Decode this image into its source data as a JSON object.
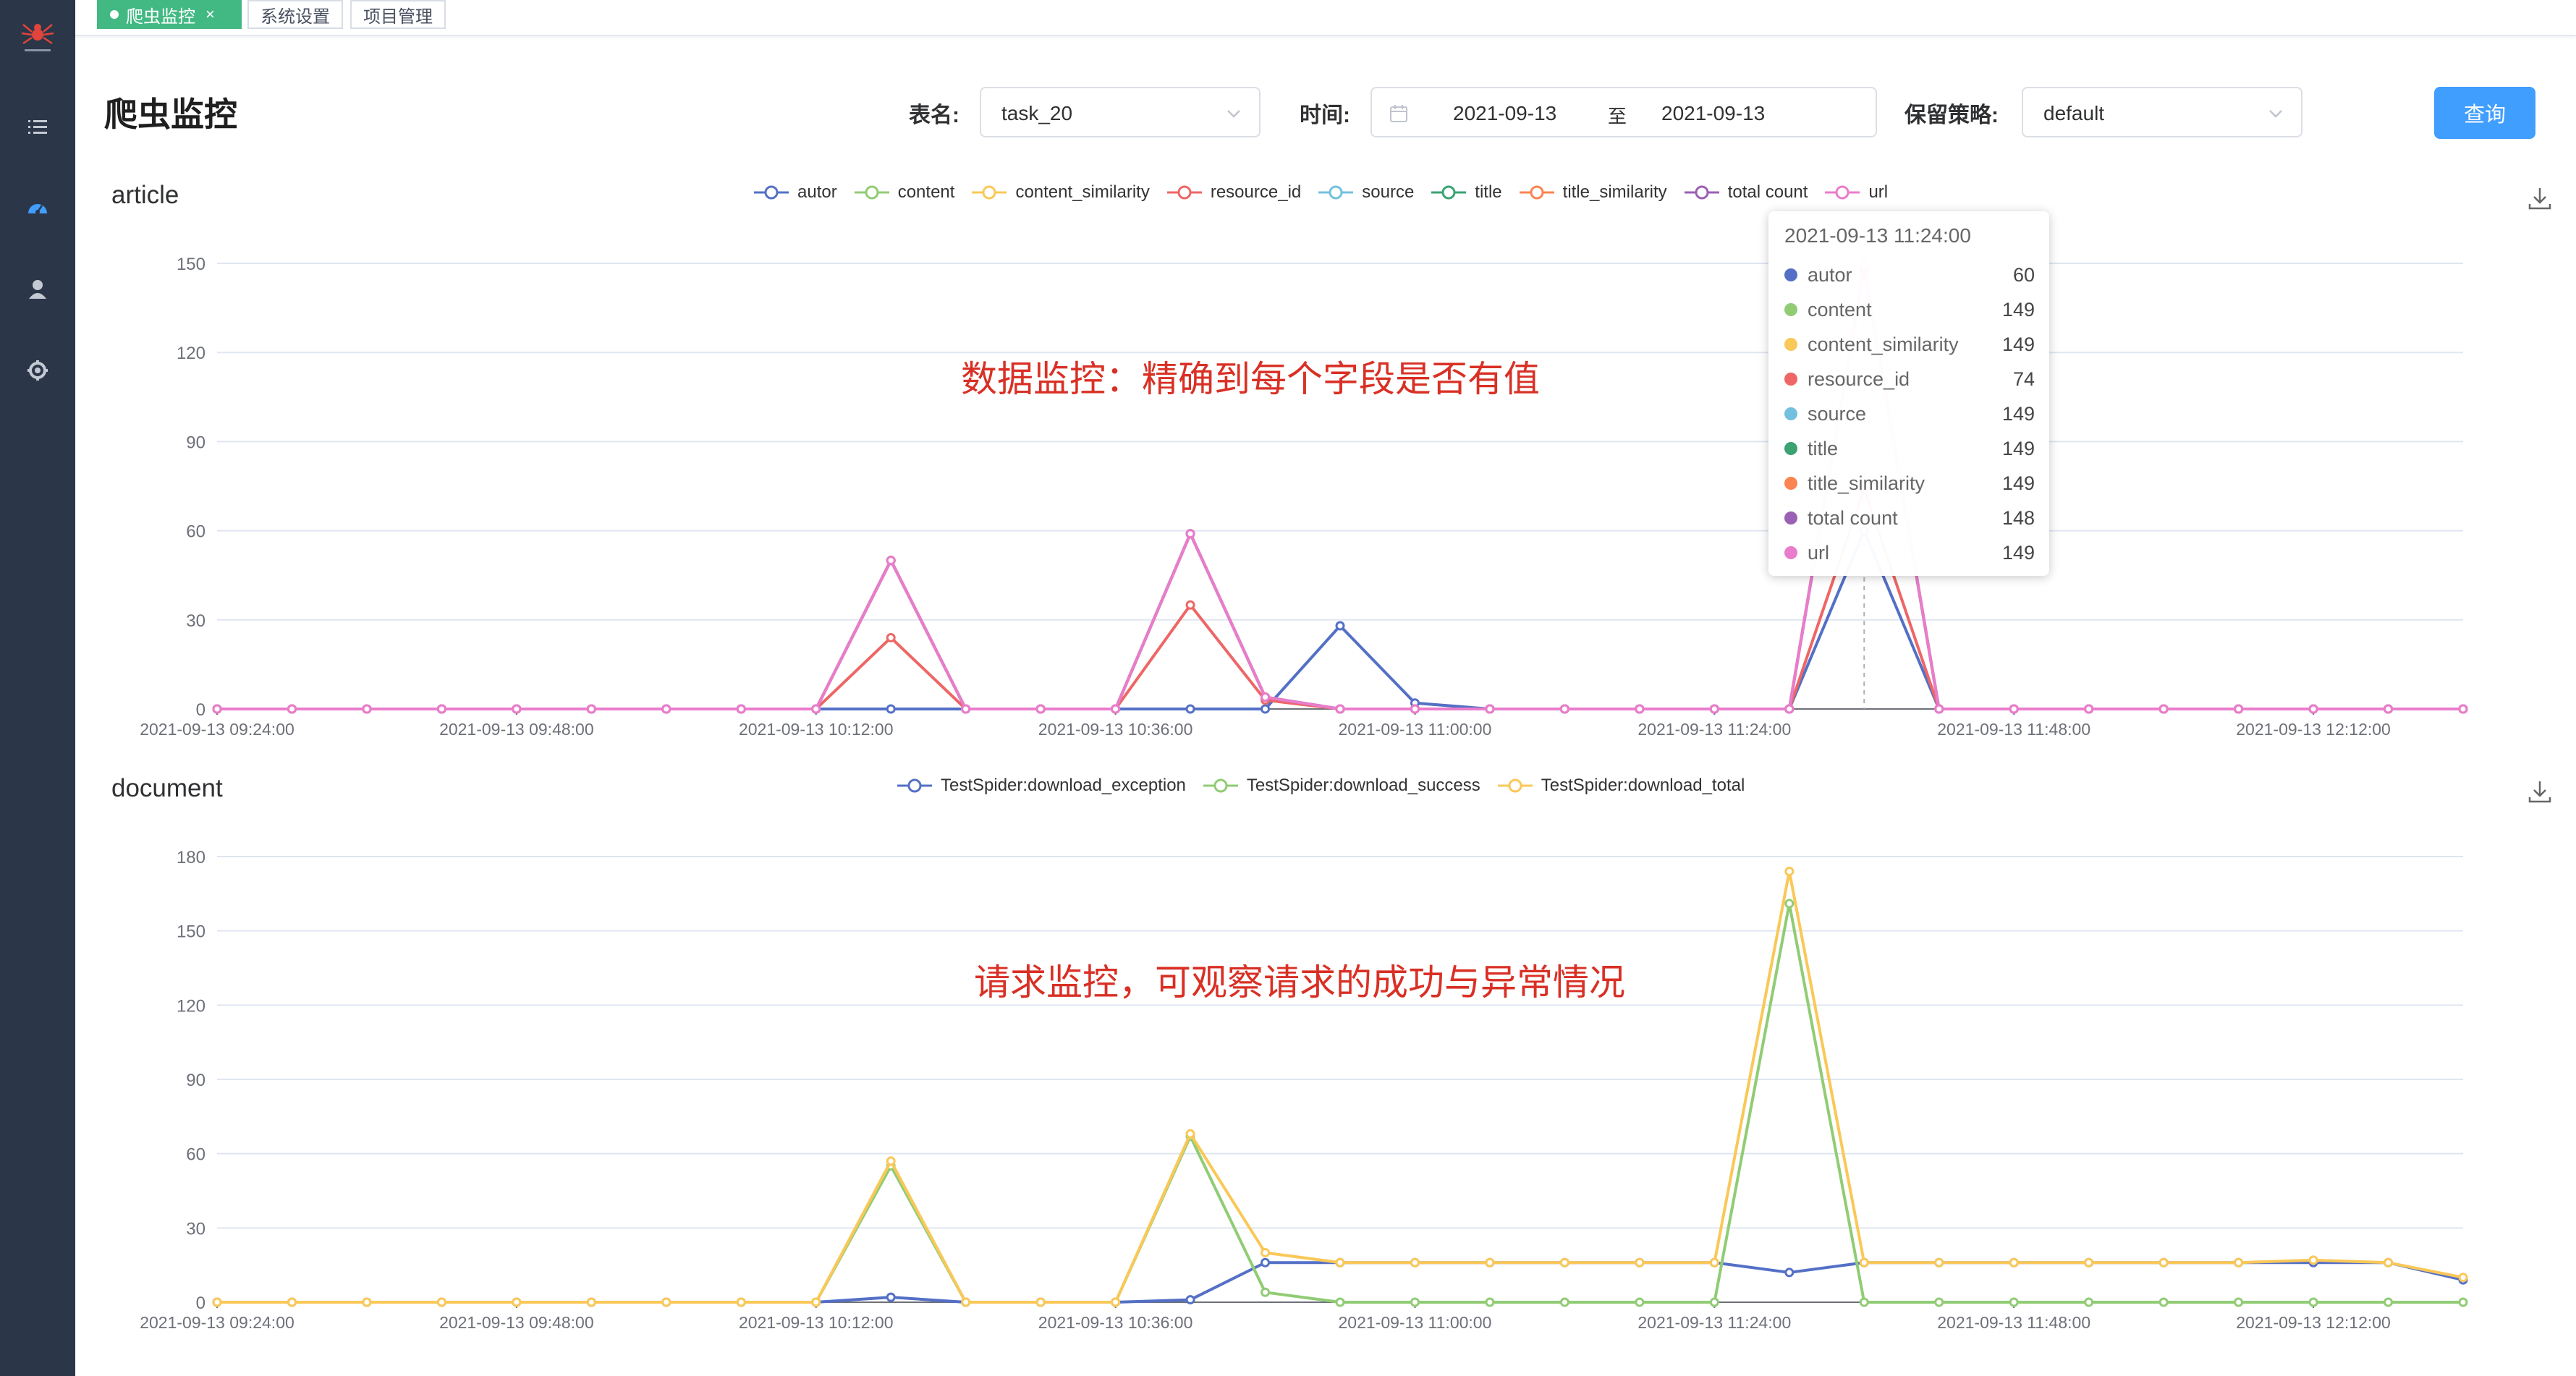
{
  "tabs": [
    {
      "label": "爬虫监控",
      "active": true
    },
    {
      "label": "系统设置",
      "active": false
    },
    {
      "label": "项目管理",
      "active": false
    }
  ],
  "page": {
    "title": "爬虫监控"
  },
  "filters": {
    "table_label": "表名:",
    "table_value": "task_20",
    "time_label": "时间:",
    "date_start": "2021-09-13",
    "date_sep": "至",
    "date_end": "2021-09-13",
    "policy_label": "保留策略:",
    "policy_value": "default",
    "query_label": "查询"
  },
  "annotations": {
    "article": "数据监控：精确到每个字段是否有值",
    "document": "请求监控，可观察请求的成功与异常情况"
  },
  "tooltip": {
    "title": "2021-09-13 11:24:00",
    "rows": [
      {
        "name": "autor",
        "value": "60",
        "color": "#5470c6"
      },
      {
        "name": "content",
        "value": "149",
        "color": "#91cc75"
      },
      {
        "name": "content_similarity",
        "value": "149",
        "color": "#fac858"
      },
      {
        "name": "resource_id",
        "value": "74",
        "color": "#ee6666"
      },
      {
        "name": "source",
        "value": "149",
        "color": "#73c0de"
      },
      {
        "name": "title",
        "value": "149",
        "color": "#3ba272"
      },
      {
        "name": "title_similarity",
        "value": "149",
        "color": "#fc8452"
      },
      {
        "name": "total count",
        "value": "148",
        "color": "#9a60b4"
      },
      {
        "name": "url",
        "value": "149",
        "color": "#ea7ccc"
      }
    ]
  },
  "chart_data": [
    {
      "type": "line",
      "title": "article",
      "x_ticks": [
        "2021-09-13 09:24:00",
        "2021-09-13 09:48:00",
        "2021-09-13 10:12:00",
        "2021-09-13 10:36:00",
        "2021-09-13 11:00:00",
        "2021-09-13 11:24:00",
        "2021-09-13 11:48:00",
        "2021-09-13 12:12:00"
      ],
      "y_ticks": [
        0,
        30,
        60,
        90,
        120,
        150
      ],
      "ylim": [
        0,
        150
      ],
      "x_count": 31,
      "legend_position": "top-center",
      "grid": true,
      "series": [
        {
          "name": "autor",
          "color": "#5470c6",
          "values": [
            0,
            0,
            0,
            0,
            0,
            0,
            0,
            0,
            0,
            0,
            0,
            0,
            0,
            0,
            0,
            28,
            2,
            0,
            0,
            0,
            0,
            0,
            60,
            0,
            0,
            0,
            0,
            0,
            0,
            0,
            0
          ]
        },
        {
          "name": "content",
          "color": "#91cc75",
          "values": [
            0,
            0,
            0,
            0,
            0,
            0,
            0,
            0,
            0,
            50,
            0,
            0,
            0,
            59,
            4,
            0,
            0,
            0,
            0,
            0,
            0,
            0,
            149,
            0,
            0,
            0,
            0,
            0,
            0,
            0,
            0
          ]
        },
        {
          "name": "content_similarity",
          "color": "#fac858",
          "values": [
            0,
            0,
            0,
            0,
            0,
            0,
            0,
            0,
            0,
            50,
            0,
            0,
            0,
            59,
            4,
            0,
            0,
            0,
            0,
            0,
            0,
            0,
            149,
            0,
            0,
            0,
            0,
            0,
            0,
            0,
            0
          ]
        },
        {
          "name": "resource_id",
          "color": "#ee6666",
          "values": [
            0,
            0,
            0,
            0,
            0,
            0,
            0,
            0,
            0,
            24,
            0,
            0,
            0,
            35,
            3,
            0,
            0,
            0,
            0,
            0,
            0,
            0,
            74,
            0,
            0,
            0,
            0,
            0,
            0,
            0,
            0
          ]
        },
        {
          "name": "source",
          "color": "#73c0de",
          "values": [
            0,
            0,
            0,
            0,
            0,
            0,
            0,
            0,
            0,
            50,
            0,
            0,
            0,
            59,
            4,
            0,
            0,
            0,
            0,
            0,
            0,
            0,
            149,
            0,
            0,
            0,
            0,
            0,
            0,
            0,
            0
          ]
        },
        {
          "name": "title",
          "color": "#3ba272",
          "values": [
            0,
            0,
            0,
            0,
            0,
            0,
            0,
            0,
            0,
            50,
            0,
            0,
            0,
            59,
            4,
            0,
            0,
            0,
            0,
            0,
            0,
            0,
            149,
            0,
            0,
            0,
            0,
            0,
            0,
            0,
            0
          ]
        },
        {
          "name": "title_similarity",
          "color": "#fc8452",
          "values": [
            0,
            0,
            0,
            0,
            0,
            0,
            0,
            0,
            0,
            50,
            0,
            0,
            0,
            59,
            4,
            0,
            0,
            0,
            0,
            0,
            0,
            0,
            149,
            0,
            0,
            0,
            0,
            0,
            0,
            0,
            0
          ]
        },
        {
          "name": "total count",
          "color": "#9a60b4",
          "values": [
            0,
            0,
            0,
            0,
            0,
            0,
            0,
            0,
            0,
            50,
            0,
            0,
            0,
            59,
            4,
            0,
            0,
            0,
            0,
            0,
            0,
            0,
            148,
            0,
            0,
            0,
            0,
            0,
            0,
            0,
            0
          ]
        },
        {
          "name": "url",
          "color": "#ea7ccc",
          "values": [
            0,
            0,
            0,
            0,
            0,
            0,
            0,
            0,
            0,
            50,
            0,
            0,
            0,
            59,
            4,
            0,
            0,
            0,
            0,
            0,
            0,
            0,
            149,
            0,
            0,
            0,
            0,
            0,
            0,
            0,
            0
          ]
        }
      ]
    },
    {
      "type": "line",
      "title": "document",
      "x_ticks": [
        "2021-09-13 09:24:00",
        "2021-09-13 09:48:00",
        "2021-09-13 10:12:00",
        "2021-09-13 10:36:00",
        "2021-09-13 11:00:00",
        "2021-09-13 11:24:00",
        "2021-09-13 11:48:00",
        "2021-09-13 12:12:00"
      ],
      "y_ticks": [
        0,
        30,
        60,
        90,
        120,
        150,
        180
      ],
      "ylim": [
        0,
        180
      ],
      "x_count": 31,
      "legend_position": "top-center",
      "grid": true,
      "series": [
        {
          "name": "TestSpider:download_exception",
          "color": "#5470c6",
          "values": [
            0,
            0,
            0,
            0,
            0,
            0,
            0,
            0,
            0,
            2,
            0,
            0,
            0,
            1,
            16,
            16,
            16,
            16,
            16,
            16,
            16,
            12,
            16,
            16,
            16,
            16,
            16,
            16,
            16,
            16,
            9
          ]
        },
        {
          "name": "TestSpider:download_success",
          "color": "#91cc75",
          "values": [
            0,
            0,
            0,
            0,
            0,
            0,
            0,
            0,
            0,
            55,
            0,
            0,
            0,
            67,
            4,
            0,
            0,
            0,
            0,
            0,
            0,
            161,
            0,
            0,
            0,
            0,
            0,
            0,
            0,
            0,
            0
          ]
        },
        {
          "name": "TestSpider:download_total",
          "color": "#fac858",
          "values": [
            0,
            0,
            0,
            0,
            0,
            0,
            0,
            0,
            0,
            57,
            0,
            0,
            0,
            68,
            20,
            16,
            16,
            16,
            16,
            16,
            16,
            174,
            16,
            16,
            16,
            16,
            16,
            16,
            17,
            16,
            10
          ]
        }
      ]
    }
  ]
}
